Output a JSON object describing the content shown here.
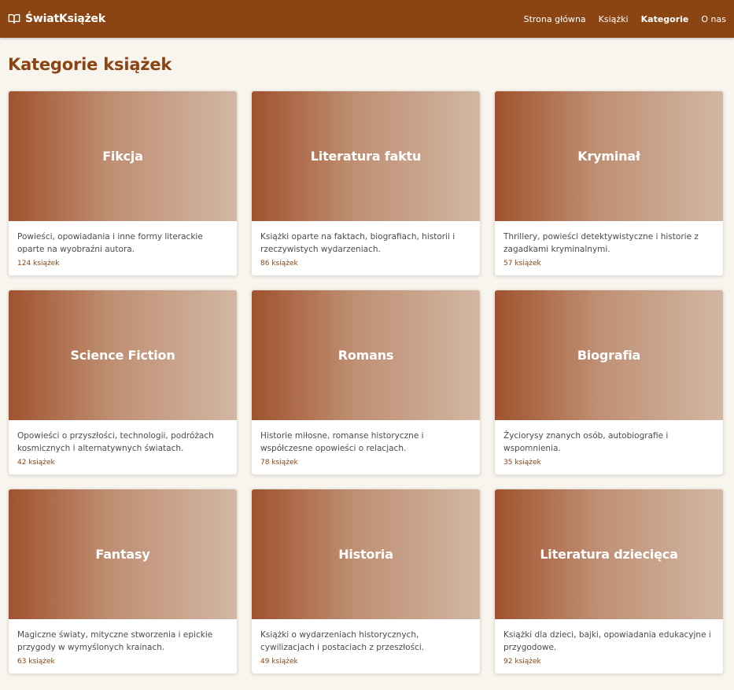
{
  "header": {
    "brand": "ŚwiatKsiążek",
    "nav": [
      {
        "label": "Strona główna",
        "active": false
      },
      {
        "label": "Książki",
        "active": false
      },
      {
        "label": "Kategorie",
        "active": true
      },
      {
        "label": "O nas",
        "active": false
      }
    ]
  },
  "main": {
    "title": "Kategorie książek",
    "categories": [
      {
        "name": "Fikcja",
        "description": "Powieści, opowiadania i inne formy literackie oparte na wyobraźni autora.",
        "count": "124 książek"
      },
      {
        "name": "Literatura faktu",
        "description": "Książki oparte na faktach, biografiach, historii i rzeczywistych wydarzeniach.",
        "count": "86 książek"
      },
      {
        "name": "Kryminał",
        "description": "Thrillery, powieści detektywistyczne i historie z zagadkami kryminalnymi.",
        "count": "57 książek"
      },
      {
        "name": "Science Fiction",
        "description": "Opowieści o przyszłości, technologii, podróżach kosmicznych i alternatywnych światach.",
        "count": "42 książek"
      },
      {
        "name": "Romans",
        "description": "Historie miłosne, romanse historyczne i współczesne opowieści o relacjach.",
        "count": "78 książek"
      },
      {
        "name": "Biografia",
        "description": "Życiorysy znanych osób, autobiografie i wspomnienia.",
        "count": "35 książek"
      },
      {
        "name": "Fantasy",
        "description": "Magiczne światy, mityczne stworzenia i epickie przygody w wymyślonych krainach.",
        "count": "63 książek"
      },
      {
        "name": "Historia",
        "description": "Książki o wydarzeniach historycznych, cywilizacjach i postaciach z przeszłości.",
        "count": "49 książek"
      },
      {
        "name": "Literatura dziecięca",
        "description": "Książki dla dzieci, bajki, opowiadania edukacyjne i przygodowe.",
        "count": "92 książek"
      }
    ]
  },
  "colors": {
    "header_bg": "#8b4513",
    "page_bg": "#f8f5ef",
    "accent": "#8b4513",
    "banner_left": "#a0522d",
    "banner_right": "#d2b7a3"
  },
  "icons": {
    "brand_icon": "book-open-icon"
  }
}
